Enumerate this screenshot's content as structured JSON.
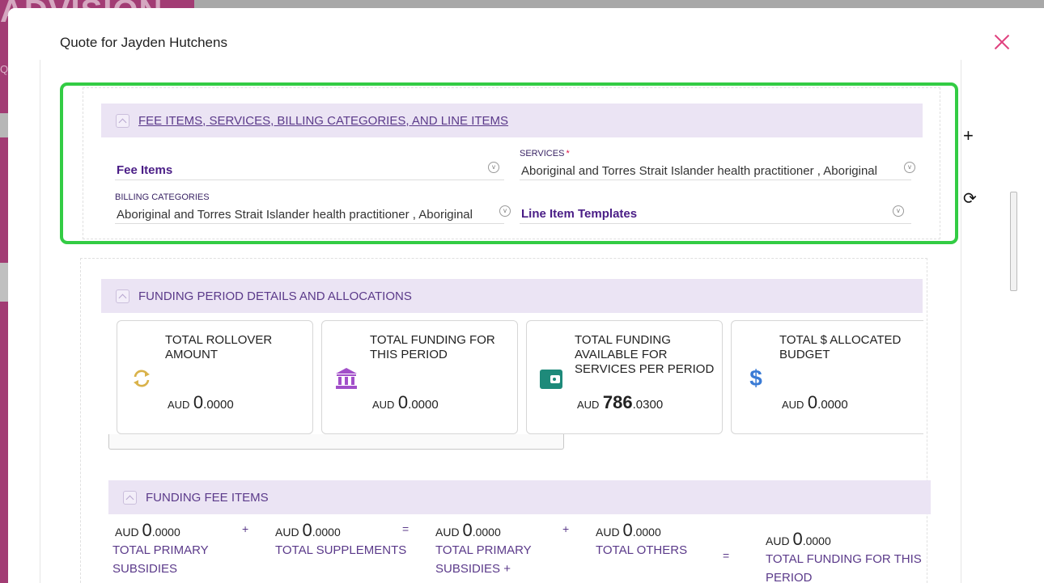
{
  "background": {
    "logo_fragment": "ADVISION",
    "left_text": "Qu"
  },
  "modal": {
    "title": "Quote for Jayden Hutchens",
    "close_icon": "close-icon"
  },
  "side_actions": {
    "add_icon": "+",
    "refresh_icon": "⟳"
  },
  "section_fee_items": {
    "header": "FEE ITEMS, SERVICES, BILLING CATEGORIES, AND LINE ITEMS",
    "fee_items": {
      "placeholder": "Fee Items"
    },
    "services": {
      "label": "SERVICES",
      "required_mark": "*",
      "value": "Aboriginal and Torres Strait Islander health practitioner , Aboriginal"
    },
    "billing_categories": {
      "label": "BILLING CATEGORIES",
      "value": "Aboriginal and Torres Strait Islander health practitioner , Aboriginal"
    },
    "line_items": {
      "placeholder": "Line Item Templates"
    }
  },
  "section_funding": {
    "header": "FUNDING PERIOD DETAILS AND ALLOCATIONS",
    "cards": [
      {
        "label": "TOTAL ROLLOVER AMOUNT",
        "currency": "AUD",
        "int": "0",
        "dec": ".0000",
        "icon": "refresh-icon",
        "color": "#d9b24a"
      },
      {
        "label": "TOTAL FUNDING FOR THIS PERIOD",
        "currency": "AUD",
        "int": "0",
        "dec": ".0000",
        "icon": "bank-icon",
        "color": "#a24fc9"
      },
      {
        "label": "TOTAL FUNDING AVAILABLE FOR SERVICES PER PERIOD",
        "currency": "AUD",
        "int": "786",
        "dec": ".0300",
        "icon": "wallet-icon",
        "color": "#1e8a7a"
      },
      {
        "label": "TOTAL $ ALLOCATED BUDGET",
        "currency": "AUD",
        "int": "0",
        "dec": ".0000",
        "icon": "dollar-icon",
        "color": "#3a7bd5"
      }
    ]
  },
  "section_funding_fee_items": {
    "header": "FUNDING FEE ITEMS",
    "items": [
      {
        "currency": "AUD",
        "int": "0",
        "dec": ".0000",
        "label": "TOTAL PRIMARY SUBSIDIES"
      },
      {
        "currency": "AUD",
        "int": "0",
        "dec": ".0000",
        "label": "TOTAL SUPPLEMENTS"
      },
      {
        "currency": "AUD",
        "int": "0",
        "dec": ".0000",
        "label": "TOTAL PRIMARY SUBSIDIES + SUPPLEMENTS"
      },
      {
        "currency": "AUD",
        "int": "0",
        "dec": ".0000",
        "label": "TOTAL OTHERS"
      },
      {
        "currency": "AUD",
        "int": "0",
        "dec": ".0000",
        "label": "TOTAL FUNDING FOR THIS PERIOD"
      }
    ],
    "operators": [
      "+",
      "=",
      "+",
      "="
    ]
  }
}
